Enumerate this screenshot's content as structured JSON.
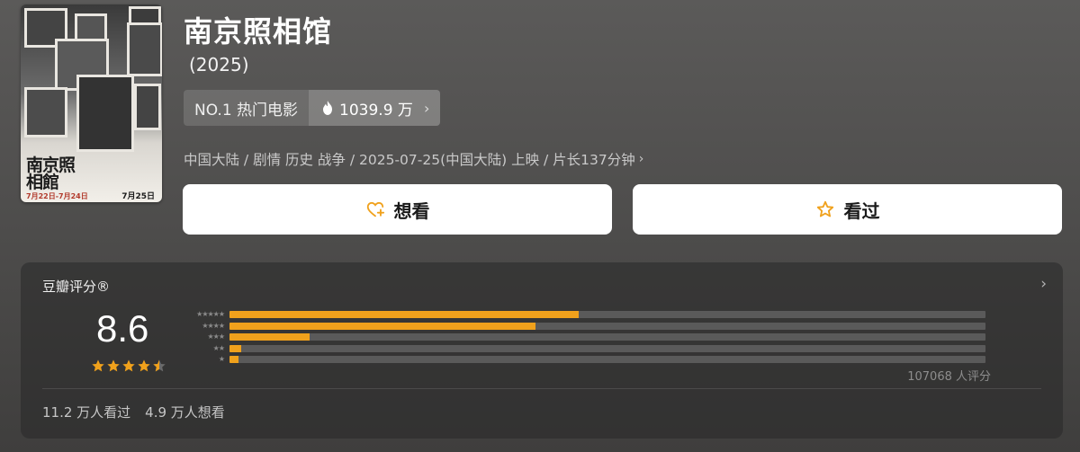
{
  "movie": {
    "title": "南京照相馆",
    "year": "(2025)",
    "rank_label": "NO.1 热门电影",
    "heat_value": "1039.9 万",
    "meta_line": "中国大陆 / 剧情 历史 战争 / 2025-07-25(中国大陆) 上映 / 片长137分钟",
    "poster": {
      "calligraphy": "南京照相館",
      "date_left": "7月22日-7月24日",
      "date_right": "7月25日"
    }
  },
  "actions": {
    "want_label": "想看",
    "seen_label": "看过"
  },
  "rating": {
    "section_title": "豆瓣评分®",
    "score": "8.6",
    "star_level": 4.5,
    "distribution": [
      {
        "stars": "★★★★★",
        "percent": 46.2
      },
      {
        "stars": "★★★★",
        "percent": 40.5
      },
      {
        "stars": "★★★",
        "percent": 10.6
      },
      {
        "stars": "★★",
        "percent": 1.5
      },
      {
        "stars": "★",
        "percent": 1.2
      }
    ],
    "count_label": "107068 人评分",
    "seen_count": "11.2 万人看过",
    "want_count": "4.9 万人想看"
  },
  "colors": {
    "accent": "#f0a11c",
    "track": "#5a5a5a"
  },
  "icons": {
    "heat": "flame-icon",
    "want": "heart-plus-icon",
    "seen": "star-outline-icon",
    "nav": "chevron-right-icon"
  }
}
